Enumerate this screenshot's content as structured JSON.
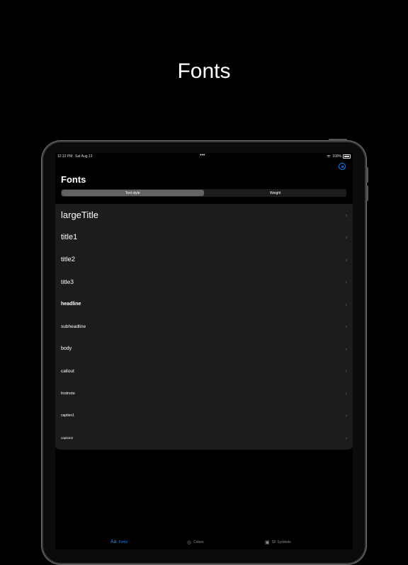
{
  "headline": "Fonts",
  "status_bar": {
    "time": "12:13 PM",
    "date": "Sat Aug 13",
    "dots": "•••",
    "battery": "100%"
  },
  "nav": {
    "title": "Fonts"
  },
  "segmented": {
    "options": [
      "Text style",
      "Weight"
    ],
    "selected": "Text style"
  },
  "rows": [
    {
      "label": "largeTitle"
    },
    {
      "label": "title1"
    },
    {
      "label": "title2"
    },
    {
      "label": "title3"
    },
    {
      "label": "headline"
    },
    {
      "label": "subheadline"
    },
    {
      "label": "body"
    },
    {
      "label": "callout"
    },
    {
      "label": "footnote"
    },
    {
      "label": "caption1"
    },
    {
      "label": "caption2"
    }
  ],
  "chevron": "›",
  "tabs": [
    {
      "icon": "Aa",
      "label": "Fonts"
    },
    {
      "icon": "◎",
      "label": "Colors"
    },
    {
      "icon": "▣",
      "label": "SF Symbols"
    }
  ],
  "colors": {
    "accent": "#0a84ff",
    "list_bg": "#1c1c1e",
    "chevron": "#636366"
  }
}
